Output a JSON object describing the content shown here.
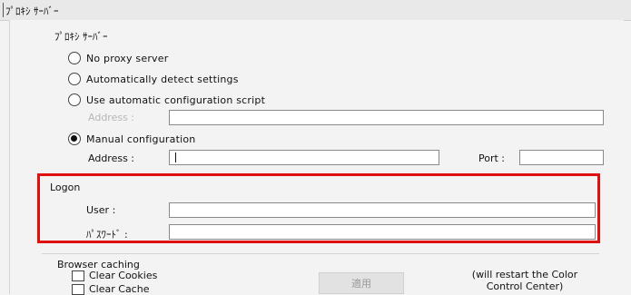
{
  "window": {
    "title": "ﾌﾟﾛｷｼ ｻｰﾊﾞｰ"
  },
  "proxy": {
    "group_title": "ﾌﾟﾛｷｼ ｻｰﾊﾞｰ",
    "options": [
      {
        "label": "No proxy server",
        "checked": false
      },
      {
        "label": "Automatically detect settings",
        "checked": false
      },
      {
        "label": "Use automatic configuration script",
        "checked": false
      },
      {
        "label": "Manual configuration",
        "checked": true
      }
    ],
    "script_address_label": "Address :",
    "script_address_value": "",
    "manual_address_label": "Address :",
    "manual_address_value": "",
    "port_label": "Port :",
    "port_value": ""
  },
  "logon": {
    "title": "Logon",
    "user_label": "User :",
    "user_value": "",
    "password_label": "ﾊﾟｽﾜｰﾄﾞ :",
    "password_value": ""
  },
  "browser_caching": {
    "title": "Browser caching",
    "clear_cookies_label": "Clear Cookies",
    "clear_cache_label": "Clear Cache",
    "clear_cookies_checked": false,
    "clear_cache_checked": false
  },
  "apply_button": {
    "label": "適用",
    "enabled": false
  },
  "restart_note": {
    "line1": "(will restart the Color",
    "line2": "Control Center)"
  },
  "colors": {
    "highlight": "#e01010",
    "disabled_text": "#b7b7b7"
  }
}
